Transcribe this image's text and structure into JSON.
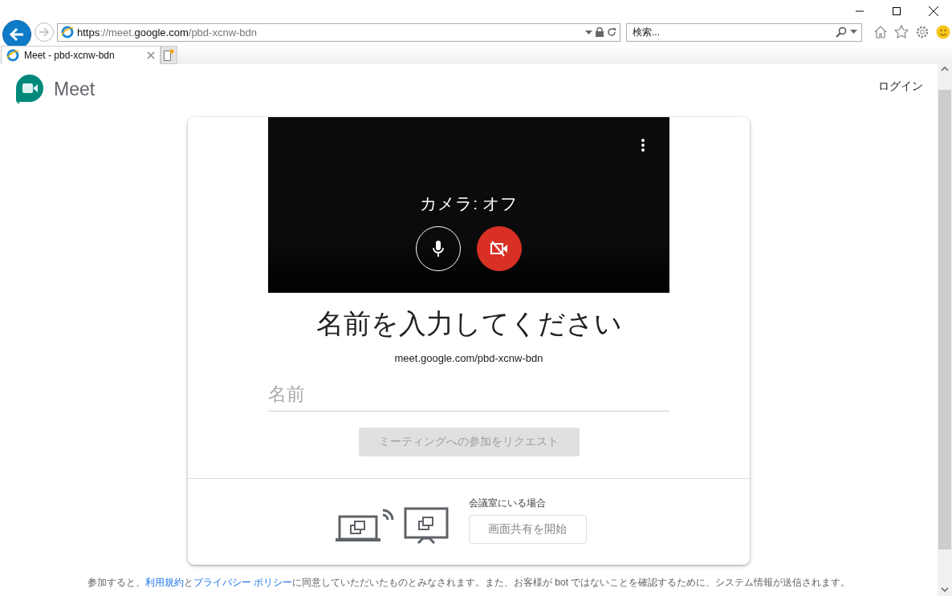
{
  "browser": {
    "url": [
      {
        "text": "https",
        "dim": false
      },
      {
        "text": "://meet.",
        "dim": true
      },
      {
        "text": "google.com",
        "dim": false
      },
      {
        "text": "/pbd-xcnw-bdn",
        "dim": true
      }
    ],
    "search": {
      "placeholder": "検索..."
    },
    "tabs": [
      {
        "label": "Meet - pbd-xcnw-bdn",
        "selected": true
      }
    ]
  },
  "header": {
    "app_name": "Meet",
    "login": "ログイン"
  },
  "preview": {
    "status": "カメラ: オフ",
    "mic_on": true,
    "camera_on": false
  },
  "title": "名前を入力してください",
  "meeting_link": "meet.google.com/pbd-xcnw-bdn",
  "name_field": {
    "placeholder": "名前"
  },
  "join_button": {
    "label": "ミーティングへの参加をリクエスト",
    "disabled": true
  },
  "room": {
    "label": "会議室にいる場合",
    "button": "画面共有を開始"
  },
  "footer": [
    {
      "kind": "text",
      "text": "参加すると、"
    },
    {
      "kind": "link",
      "text": "利用規約"
    },
    {
      "kind": "text",
      "text": "と"
    },
    {
      "kind": "link",
      "text": "プライバシー ポリシー"
    },
    {
      "kind": "text",
      "text": "に同意していただいたものとみなされます。また、お客様が bot ではないことを確認するために、システム情報が送信されます。"
    }
  ]
}
